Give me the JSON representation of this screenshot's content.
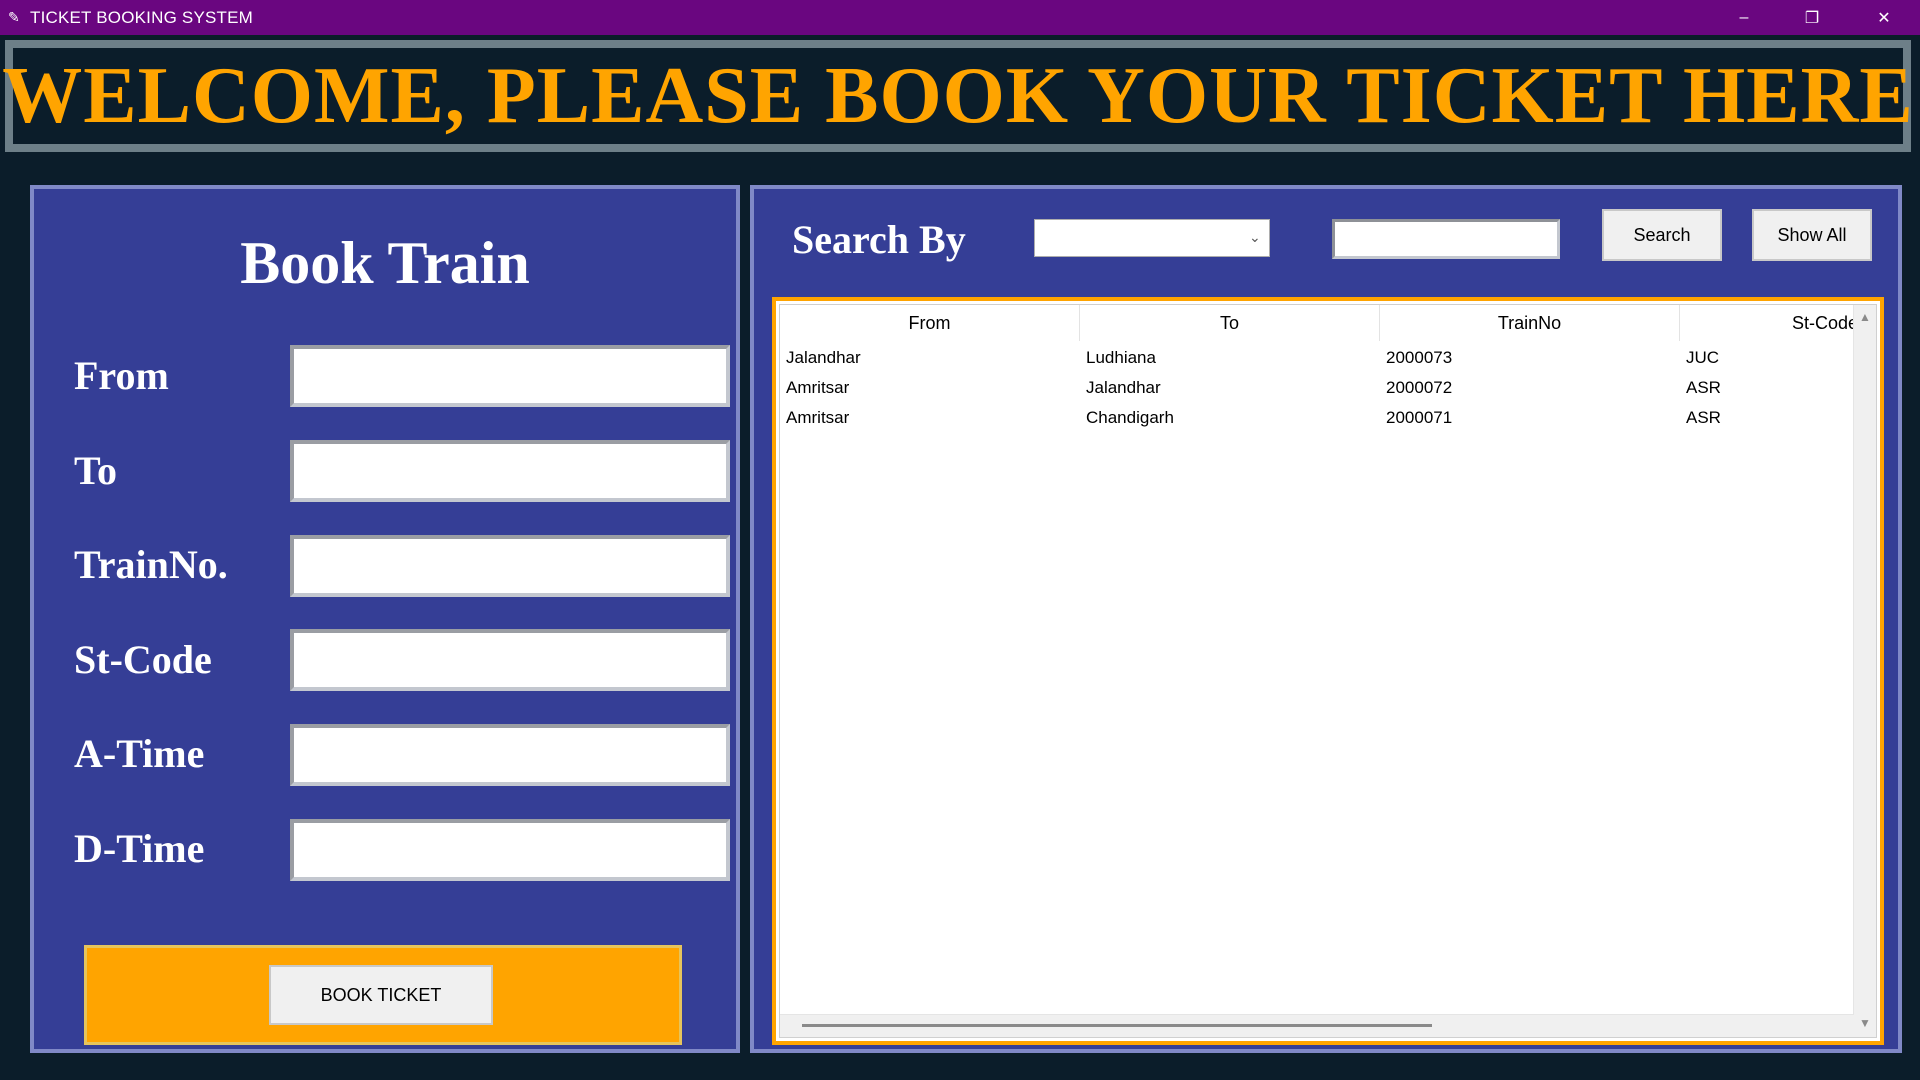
{
  "window": {
    "title": "TICKET BOOKING SYSTEM",
    "controls": {
      "minimize": "–",
      "maximize": "❐",
      "close": "✕"
    }
  },
  "header": {
    "banner_text": "WELCOME, PLEASE BOOK YOUR TICKET HERE"
  },
  "book_panel": {
    "title": "Book Train",
    "fields": [
      {
        "label": "From",
        "value": ""
      },
      {
        "label": "To",
        "value": ""
      },
      {
        "label": "TrainNo.",
        "value": ""
      },
      {
        "label": "St-Code",
        "value": ""
      },
      {
        "label": "A-Time",
        "value": ""
      },
      {
        "label": "D-Time",
        "value": ""
      }
    ],
    "book_button_label": "BOOK TICKET"
  },
  "search_panel": {
    "label": "Search By",
    "combo_value": "",
    "search_text": "",
    "search_button_label": "Search",
    "show_all_button_label": "Show All"
  },
  "table": {
    "columns": [
      "From",
      "To",
      "TrainNo",
      "St-Code"
    ],
    "rows": [
      [
        "Jalandhar",
        "Ludhiana",
        "2000073",
        "JUC"
      ],
      [
        "Amritsar",
        "Jalandhar",
        "2000072",
        "ASR"
      ],
      [
        "Amritsar",
        "Chandigarh",
        "2000071",
        "ASR"
      ]
    ]
  },
  "colors": {
    "titlebar": "#6a0680",
    "banner_text": "#ffa400",
    "panel_bg": "#353e96",
    "accent": "#ffa400"
  }
}
